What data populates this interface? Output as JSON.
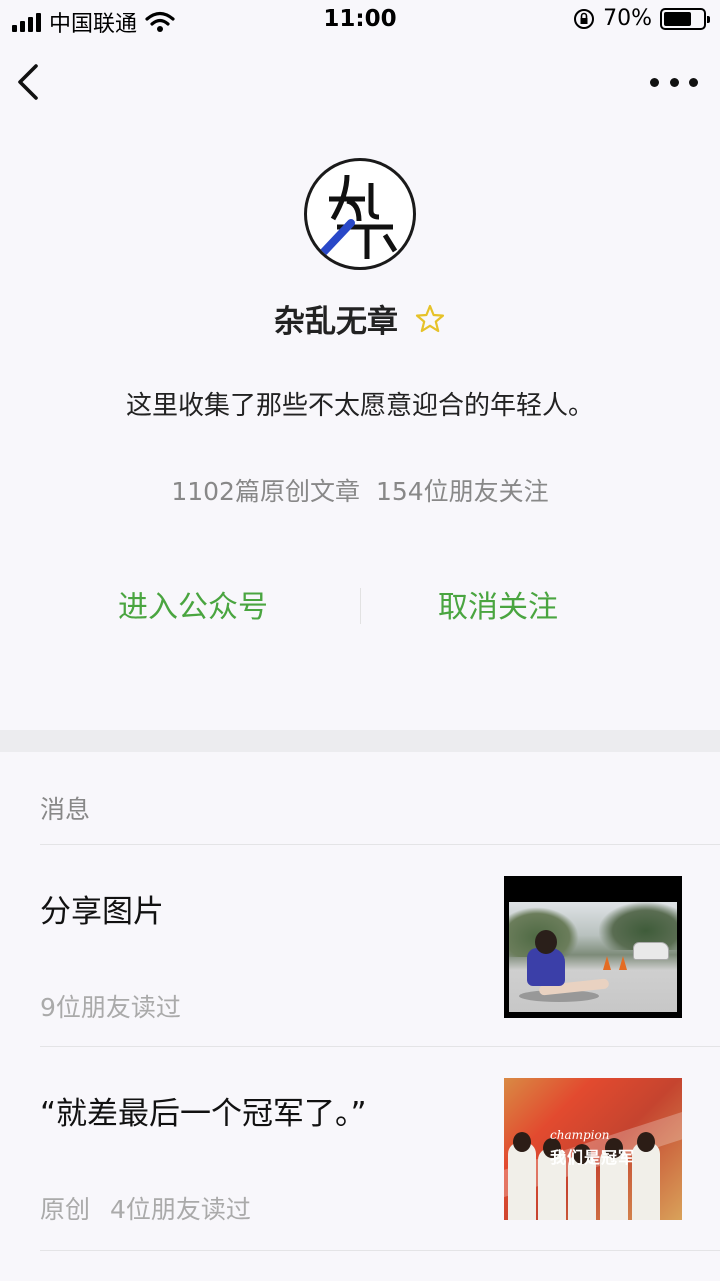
{
  "status_bar": {
    "carrier": "中国联通",
    "time": "11:00",
    "battery_percent": "70%",
    "battery_level": 0.7
  },
  "nav": {
    "back_icon": "chevron-left-icon",
    "more_icon": "more-horizontal-icon"
  },
  "profile": {
    "name": "杂乱无章",
    "star_icon": "star-outline-icon",
    "star_color": "#e6c229",
    "description": "这里收集了那些不太愿意迎合的年轻人。",
    "stats": {
      "articles": "1102篇原创文章",
      "followers": "154位朋友关注"
    }
  },
  "actions": {
    "enter_label": "进入公众号",
    "unfollow_label": "取消关注",
    "accent_color": "#4aa540"
  },
  "messages": {
    "header": "消息",
    "items": [
      {
        "title": "分享图片",
        "tag": "",
        "meta": "9位朋友读过"
      },
      {
        "title": "“就差最后一个冠军了。”",
        "tag": "原创",
        "meta": "4位朋友读过"
      }
    ]
  },
  "thumb2_caption": {
    "en": "champion",
    "cn": "我们是冠军"
  }
}
